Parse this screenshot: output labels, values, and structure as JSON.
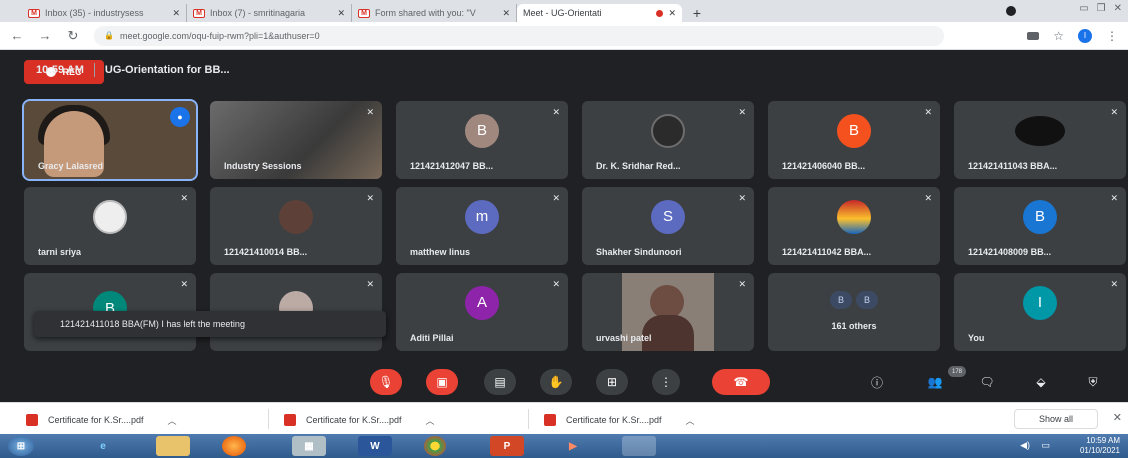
{
  "browser": {
    "tabs": [
      {
        "title": "Inbox (35) - industrysess",
        "icon": "gmail-icon",
        "active": false
      },
      {
        "title": "Inbox (7) - smritinagaria",
        "icon": "gmail-icon",
        "active": false
      },
      {
        "title": "Form shared with you: \"V",
        "icon": "gmail-icon",
        "active": false
      },
      {
        "title": "Meet - UG-Orientati",
        "icon": "meet-icon",
        "active": true
      }
    ],
    "new_tab": "+",
    "url": "meet.google.com/oqu-fuip-rwm?pli=1&authuser=0",
    "profile_initial": "I"
  },
  "meet": {
    "rec_label": "REC",
    "participants": [
      {
        "name": "Gracy Lalasred",
        "kind": "video-face",
        "active": true
      },
      {
        "name": "Industry Sessions",
        "kind": "video-blur"
      },
      {
        "name": "121421412047 BB...",
        "initial": "B",
        "color": "#a1887f"
      },
      {
        "name": "Dr. K. Sridhar Red...",
        "kind": "photo-avatar"
      },
      {
        "name": "121421406040 BB...",
        "initial": "B",
        "color": "#f4511e"
      },
      {
        "name": "121421411043 BBA...",
        "kind": "dark-avatar"
      },
      {
        "name": "tarni sriya",
        "kind": "photo-avatar-light"
      },
      {
        "name": "121421410014 BB...",
        "kind": "photo-avatar"
      },
      {
        "name": "matthew linus",
        "initial": "m",
        "color": "#5c6bc0"
      },
      {
        "name": "Shakher Sindunoori",
        "initial": "S",
        "color": "#5c6bc0"
      },
      {
        "name": "121421411042 BBA...",
        "kind": "photo-avatar-color"
      },
      {
        "name": "121421408009 BB...",
        "initial": "B",
        "color": "#1976d2"
      },
      {
        "name": "",
        "initial": "B",
        "color": "#00897b"
      },
      {
        "name": "",
        "kind": "photo-avatar"
      },
      {
        "name": "Aditi Pillai",
        "initial": "A",
        "color": "#8e24aa"
      },
      {
        "name": "urvashi patel",
        "kind": "video-person"
      },
      {
        "name": "161 others",
        "kind": "others",
        "mini": [
          "B",
          "B"
        ]
      },
      {
        "name": "You",
        "initial": "I",
        "color": "#0097a7"
      }
    ],
    "toast": "121421411018 BBA(FM) I has left the meeting",
    "time": "10:59 AM",
    "meeting_title": "UG-Orientation for BB...",
    "participant_count": "178"
  },
  "downloads": {
    "items": [
      "Certificate for K.Sr....pdf",
      "Certificate for K.Sr....pdf",
      "Certificate for K.Sr....pdf"
    ],
    "show_all": "Show all"
  },
  "taskbar": {
    "time": "10:59 AM",
    "date": "01/10/2021",
    "apps": [
      "start",
      "ie",
      "explorer",
      "firefox",
      "calculator",
      "word",
      "chrome",
      "powerpoint",
      "media",
      "chrome-window"
    ]
  }
}
